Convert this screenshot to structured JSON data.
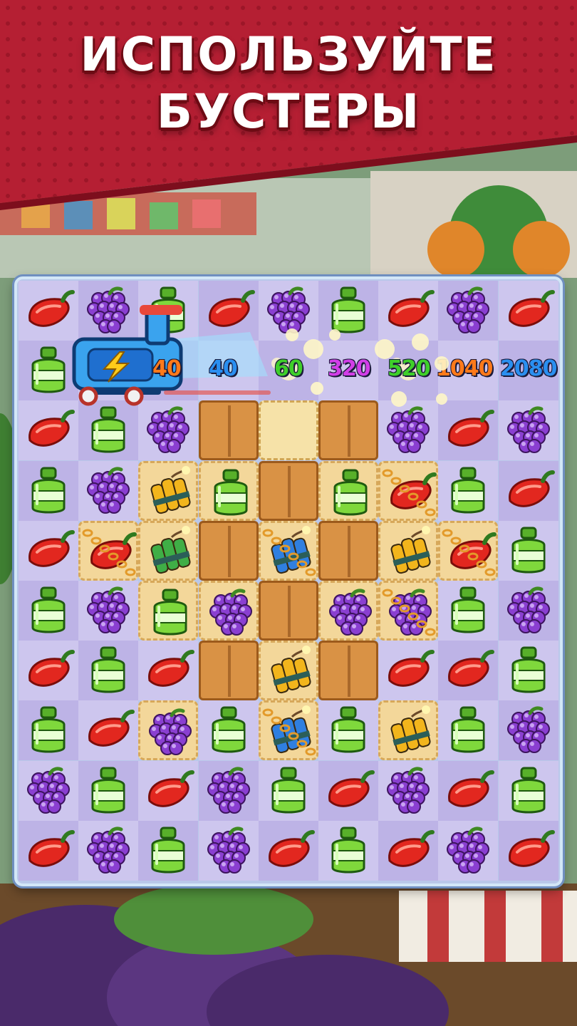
{
  "banner": {
    "title_line1": "ИСПОЛЬЗУЙТЕ",
    "title_line2": "БУСТЕРЫ",
    "color": "#b51f33"
  },
  "booster": {
    "icon": "shopping-cart-booster-icon",
    "bolt_icon": "lightning-bolt-icon"
  },
  "scores": [
    {
      "value": "40",
      "color": "#ff7a1a"
    },
    {
      "value": "40",
      "color": "#2a8ff0"
    },
    {
      "value": "60",
      "color": "#3fcf2a"
    },
    {
      "value": "320",
      "color": "#d23ee8"
    },
    {
      "value": "520",
      "color": "#3fcf2a"
    },
    {
      "value": "1040",
      "color": "#ff7a1a"
    },
    {
      "value": "2080",
      "color": "#2a8ff0"
    }
  ],
  "board": {
    "rows": 10,
    "cols": 9,
    "grid": [
      [
        "pepper",
        "grapes",
        "bottle",
        "pepper",
        "grapes",
        "bottle",
        "pepper",
        "grapes",
        "pepper"
      ],
      [
        "bottle",
        "empty",
        "empty",
        "empty",
        "sparkle",
        "empty",
        "sparkle",
        "empty",
        "empty"
      ],
      [
        "pepper",
        "bottle",
        "grapes",
        "crate",
        "oats",
        "crate",
        "grapes",
        "pepper",
        "grapes"
      ],
      [
        "bottle",
        "grapes",
        "dynamite-yellow",
        "bottle",
        "crate",
        "bottle",
        "pepper",
        "bottle",
        "pepper"
      ],
      [
        "pepper",
        "pepper",
        "dynamite-green",
        "crate",
        "dynamite-blue",
        "crate",
        "dynamite-yellow",
        "pepper",
        "bottle"
      ],
      [
        "bottle",
        "grapes",
        "bottle",
        "grapes",
        "crate",
        "grapes",
        "grapes",
        "bottle",
        "grapes"
      ],
      [
        "pepper",
        "bottle",
        "pepper",
        "crate",
        "dynamite-yellow",
        "crate",
        "pepper",
        "pepper",
        "bottle"
      ],
      [
        "bottle",
        "pepper",
        "grapes",
        "bottle",
        "dynamite-blue",
        "bottle",
        "dynamite-yellow",
        "bottle",
        "grapes"
      ],
      [
        "grapes",
        "bottle",
        "pepper",
        "grapes",
        "bottle",
        "pepper",
        "grapes",
        "pepper",
        "bottle"
      ],
      [
        "pepper",
        "grapes",
        "bottle",
        "grapes",
        "pepper",
        "bottle",
        "pepper",
        "grapes",
        "pepper"
      ]
    ],
    "tiles": [
      [
        "light",
        "dark",
        "light",
        "dark",
        "light",
        "dark",
        "light",
        "dark",
        "light"
      ],
      [
        "dark",
        "light",
        "dark",
        "light",
        "dark",
        "light",
        "dark",
        "light",
        "dark"
      ],
      [
        "light",
        "dark",
        "light",
        "crate",
        "oats",
        "crate",
        "light",
        "dark",
        "light"
      ],
      [
        "dark",
        "light",
        "cracker",
        "cracker",
        "crate",
        "cracker",
        "cracker",
        "light",
        "dark"
      ],
      [
        "light",
        "cracker",
        "cracker",
        "crate",
        "cracker",
        "crate",
        "cracker",
        "cracker",
        "light"
      ],
      [
        "dark",
        "light",
        "cracker",
        "cracker",
        "crate",
        "cracker",
        "cracker",
        "light",
        "dark"
      ],
      [
        "light",
        "dark",
        "light",
        "crate",
        "cracker",
        "crate",
        "light",
        "dark",
        "light"
      ],
      [
        "dark",
        "light",
        "cracker",
        "light",
        "cracker",
        "light",
        "cracker",
        "light",
        "dark"
      ],
      [
        "light",
        "dark",
        "light",
        "dark",
        "light",
        "dark",
        "light",
        "dark",
        "light"
      ],
      [
        "dark",
        "light",
        "dark",
        "light",
        "dark",
        "light",
        "dark",
        "light",
        "dark"
      ]
    ],
    "chained": [
      [
        3,
        6
      ],
      [
        4,
        1
      ],
      [
        4,
        4
      ],
      [
        4,
        7
      ],
      [
        5,
        6
      ],
      [
        7,
        4
      ]
    ]
  },
  "colors": {
    "pepper": "#e2271f",
    "grapes": "#8a3fd1",
    "bottle": "#7fd83c"
  }
}
